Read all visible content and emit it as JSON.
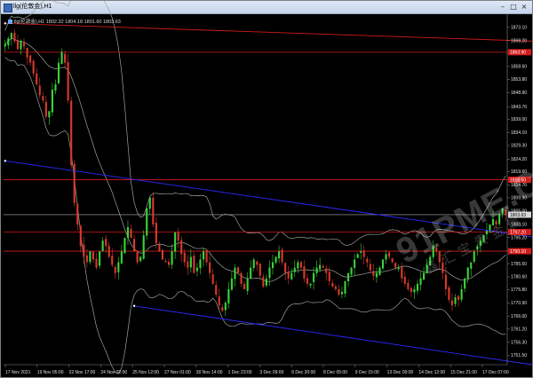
{
  "window": {
    "title": "llg(伦敦金),H1",
    "chart_label": "llg(伦敦金),H1  1802.32 1804.18 1801.60 1803.63"
  },
  "watermark": {
    "logo": "91PME.COM",
    "sub": "鑫汇宝贵金属"
  },
  "colors": {
    "background": "#000000",
    "bull": "#39d339",
    "bear": "#d63a2c",
    "bands": "#9aa39a",
    "channel_line": "#2a2aff",
    "level_line": "#d41b1b",
    "current_price_line": "#b0b0b0"
  },
  "chart_data": {
    "type": "candlestick",
    "symbol": "llg(伦敦金)",
    "timeframe": "H1",
    "ohlc_readout": {
      "open": 1802.32,
      "high": 1804.18,
      "low": 1801.6,
      "close": 1803.63
    },
    "ylim": [
      1748.0,
      1878.0
    ],
    "y_ticks": [
      1873.1,
      1868.2,
      1863.5,
      1858.6,
      1853.8,
      1848.9,
      1843.7,
      1839.0,
      1834.1,
      1829.3,
      1824.2,
      1819.6,
      1814.7,
      1809.9,
      1805.0,
      1800.1,
      1795.2,
      1790.4,
      1785.5,
      1780.6,
      1775.8,
      1770.9,
      1766.0,
      1761.2,
      1756.3,
      1751.5
    ],
    "x_ticks": [
      "17 Nov 2021",
      "19 Nov 05:00",
      "22 Nov 17:00",
      "24 Nov 02:00",
      "25 Nov 12:00",
      "27 Nov 01:00",
      "30 Nov 14:00",
      "1 Dec 23:00",
      "3 Dec 09:00",
      "6 Dec 20:00",
      "8 Dec 05:00",
      "9 Dec 15:00",
      "13 Dec 00:00",
      "14 Dec 12:00",
      "15 Dec 21:00",
      "17 Dec 07:00"
    ],
    "bar_count": 160,
    "close_series": [
      1867.0,
      1869.0,
      1871.0,
      1868.0,
      1865.0,
      1868.0,
      1866.0,
      1862.0,
      1860.0,
      1856.0,
      1852.0,
      1848.0,
      1846.0,
      1840.0,
      1842.0,
      1850.0,
      1852.0,
      1860.0,
      1864.0,
      1860.0,
      1846.0,
      1822.0,
      1808.0,
      1800.0,
      1792.0,
      1788.0,
      1786.0,
      1790.0,
      1787.0,
      1784.0,
      1790.0,
      1794.0,
      1792.0,
      1788.0,
      1785.0,
      1782.0,
      1786.0,
      1790.0,
      1795.0,
      1799.0,
      1795.0,
      1790.0,
      1786.0,
      1788.0,
      1796.0,
      1806.0,
      1810.0,
      1800.0,
      1793.0,
      1790.0,
      1787.0,
      1786.0,
      1785.0,
      1790.0,
      1797.0,
      1794.0,
      1789.0,
      1786.0,
      1784.0,
      1788.0,
      1782.0,
      1784.0,
      1787.0,
      1790.0,
      1786.0,
      1782.0,
      1778.0,
      1774.0,
      1770.0,
      1768.0,
      1771.0,
      1776.0,
      1780.0,
      1784.0,
      1782.0,
      1778.0,
      1776.0,
      1780.0,
      1784.0,
      1787.0,
      1785.0,
      1781.0,
      1777.0,
      1780.0,
      1784.0,
      1786.0,
      1788.0,
      1790.0,
      1786.0,
      1782.0,
      1780.0,
      1782.0,
      1784.0,
      1786.0,
      1784.0,
      1780.0,
      1778.0,
      1778.0,
      1782.0,
      1784.0,
      1785.0,
      1784.0,
      1782.0,
      1779.0,
      1777.0,
      1776.0,
      1774.0,
      1775.0,
      1779.0,
      1782.0,
      1784.0,
      1787.0,
      1789.0,
      1790.0,
      1788.0,
      1786.0,
      1783.0,
      1781.0,
      1782.0,
      1784.0,
      1787.0,
      1789.0,
      1788.0,
      1786.0,
      1784.0,
      1784.0,
      1780.0,
      1778.0,
      1776.0,
      1775.0,
      1776.0,
      1778.0,
      1780.0,
      1782.0,
      1785.0,
      1788.0,
      1792.0,
      1790.0,
      1786.0,
      1782.0,
      1776.0,
      1772.0,
      1770.0,
      1773.0,
      1772.0,
      1776.0,
      1780.0,
      1784.0,
      1786.0,
      1790.0,
      1792.0,
      1794.0,
      1796.0,
      1798.0,
      1800.0,
      1802.0,
      1800.0,
      1804.0,
      1806.0,
      1803.6
    ],
    "channel_lines": [
      {
        "name": "upper-trend",
        "from": [
          0,
          1823.6
        ],
        "to": [
          160,
          1795.4
        ]
      },
      {
        "name": "lower-trend",
        "from": [
          41,
          1769.8
        ],
        "to": [
          160,
          1748.0
        ]
      },
      {
        "name": "top-red-trend",
        "from": [
          0,
          1874.6
        ],
        "to": [
          160,
          1868.0
        ]
      }
    ],
    "horizontal_levels": [
      {
        "price": 1863.9,
        "label": "1863.90"
      },
      {
        "price": 1816.6,
        "label": "1816.60"
      },
      {
        "price": 1797.2,
        "label": "1797.20"
      },
      {
        "price": 1790.1,
        "label": "1790.10"
      }
    ],
    "current_price": {
      "price": 1803.63,
      "label": "1803.63"
    }
  }
}
